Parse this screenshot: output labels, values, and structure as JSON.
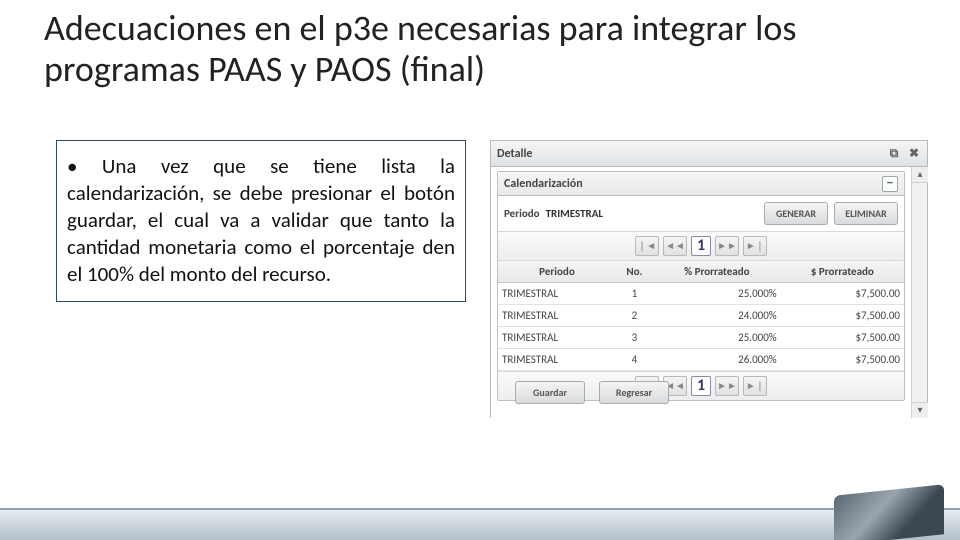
{
  "title": "Adecuaciones en el p3e necesarias para integrar los programas PAAS y PAOS (final)",
  "bullet": "Una vez que se tiene lista la calendarización, se debe presionar el botón guardar, el cual va a validar que tanto la cantidad monetaria como el porcentaje den el 100% del monto del recurso.",
  "panel": {
    "title": "Detalle",
    "popout_icon": "⧉",
    "close_icon": "✖",
    "section_title": "Calendarización",
    "collapse_icon": "−",
    "period_label": "Periodo",
    "period_value": "TRIMESTRAL",
    "btn_generate": "GENERAR",
    "btn_delete": "ELIMINAR",
    "pager": {
      "first": "❘◄",
      "prev": "◄◄",
      "current": "1",
      "next": "►►",
      "last": "►❘"
    },
    "columns": {
      "periodo": "Periodo",
      "no": "No.",
      "pct": "% Prorrateado",
      "monto": "$ Prorrateado"
    },
    "rows": [
      {
        "periodo": "TRIMESTRAL",
        "no": "1",
        "pct": "25.000%",
        "monto": "$7,500.00"
      },
      {
        "periodo": "TRIMESTRAL",
        "no": "2",
        "pct": "24.000%",
        "monto": "$7,500.00"
      },
      {
        "periodo": "TRIMESTRAL",
        "no": "3",
        "pct": "25.000%",
        "monto": "$7,500.00"
      },
      {
        "periodo": "TRIMESTRAL",
        "no": "4",
        "pct": "26.000%",
        "monto": "$7,500.00"
      }
    ],
    "btn_save": "Guardar",
    "btn_back": "Regresar",
    "scroll_up": "▴",
    "scroll_down": "▾"
  }
}
